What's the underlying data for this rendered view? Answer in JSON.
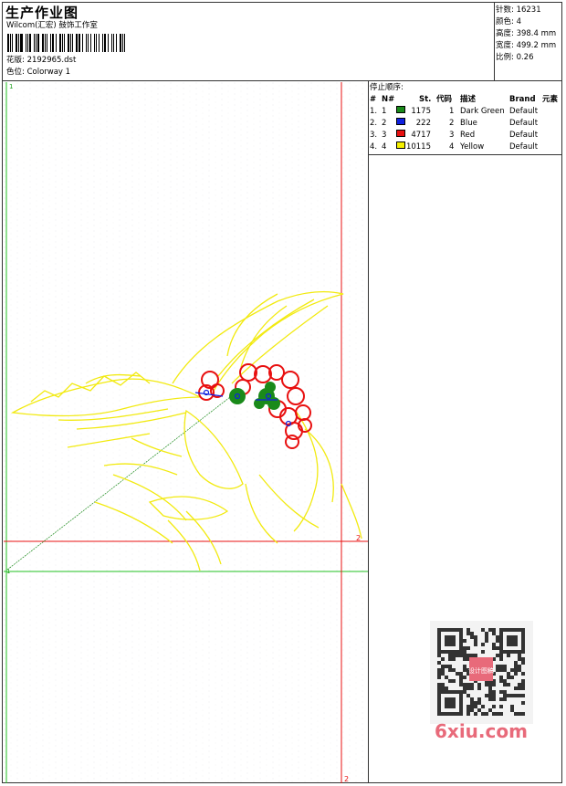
{
  "header": {
    "title": "生产作业图",
    "studio": "Wilcom(汇宏) 鼓饰工作室",
    "design_label": "花版:",
    "design_value": "2192965.dst",
    "colorway_label": "色位:",
    "colorway_value": "Colorway 1"
  },
  "stats": {
    "stitches": "针数: 16231",
    "colors": "颜色: 4",
    "height": "高度: 398.4 mm",
    "width": "宽度: 499.2 mm",
    "scale": "比例: 0.26"
  },
  "stop_sequence": {
    "title": "停止顺序:",
    "headers": {
      "index": "#",
      "number": "N#",
      "stitches": "St.",
      "code": "代码",
      "description": "描述",
      "brand": "Brand",
      "element": "元素"
    },
    "rows": [
      {
        "index": "1.",
        "number": "1",
        "color": "#1a8a1a",
        "stitches": "1175",
        "code": "1",
        "description": "Dark Green",
        "brand": "Default"
      },
      {
        "index": "2.",
        "number": "2",
        "color": "#1020e0",
        "stitches": "222",
        "code": "2",
        "description": "Blue",
        "brand": "Default"
      },
      {
        "index": "3.",
        "number": "3",
        "color": "#e81010",
        "stitches": "4717",
        "code": "3",
        "description": "Red",
        "brand": "Default"
      },
      {
        "index": "4.",
        "number": "4",
        "color": "#f5f000",
        "stitches": "10115",
        "code": "4",
        "description": "Yellow",
        "brand": "Default"
      }
    ]
  },
  "canvas": {
    "marker_top": "1",
    "marker_left": "1",
    "marker_right": "2",
    "marker_bottom": "2"
  },
  "watermark": {
    "brand": "6xiu.com",
    "seal_text": "设计图稿"
  },
  "colors": {
    "frame_red": "#e81010",
    "frame_green": "#20c020",
    "watermark_pink": "#e86a7a"
  }
}
